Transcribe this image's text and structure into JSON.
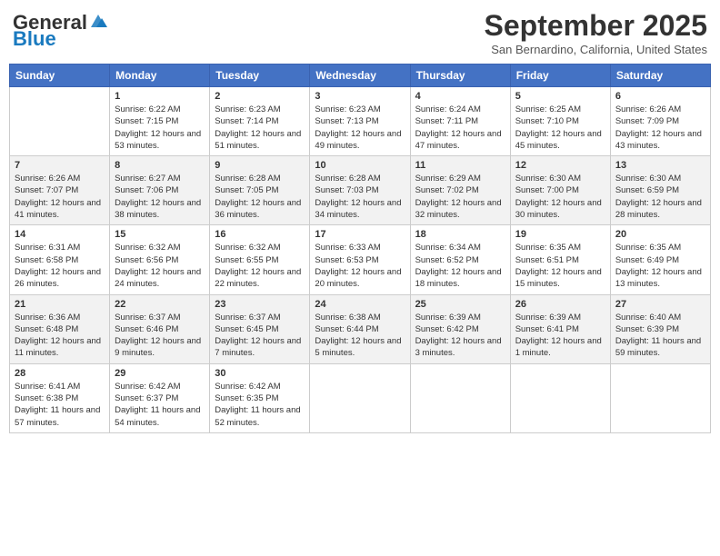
{
  "header": {
    "logo_general": "General",
    "logo_blue": "Blue",
    "month": "September 2025",
    "location": "San Bernardino, California, United States"
  },
  "days_of_week": [
    "Sunday",
    "Monday",
    "Tuesday",
    "Wednesday",
    "Thursday",
    "Friday",
    "Saturday"
  ],
  "weeks": [
    [
      {
        "day": "",
        "sunrise": "",
        "sunset": "",
        "daylight": ""
      },
      {
        "day": "1",
        "sunrise": "Sunrise: 6:22 AM",
        "sunset": "Sunset: 7:15 PM",
        "daylight": "Daylight: 12 hours and 53 minutes."
      },
      {
        "day": "2",
        "sunrise": "Sunrise: 6:23 AM",
        "sunset": "Sunset: 7:14 PM",
        "daylight": "Daylight: 12 hours and 51 minutes."
      },
      {
        "day": "3",
        "sunrise": "Sunrise: 6:23 AM",
        "sunset": "Sunset: 7:13 PM",
        "daylight": "Daylight: 12 hours and 49 minutes."
      },
      {
        "day": "4",
        "sunrise": "Sunrise: 6:24 AM",
        "sunset": "Sunset: 7:11 PM",
        "daylight": "Daylight: 12 hours and 47 minutes."
      },
      {
        "day": "5",
        "sunrise": "Sunrise: 6:25 AM",
        "sunset": "Sunset: 7:10 PM",
        "daylight": "Daylight: 12 hours and 45 minutes."
      },
      {
        "day": "6",
        "sunrise": "Sunrise: 6:26 AM",
        "sunset": "Sunset: 7:09 PM",
        "daylight": "Daylight: 12 hours and 43 minutes."
      }
    ],
    [
      {
        "day": "7",
        "sunrise": "Sunrise: 6:26 AM",
        "sunset": "Sunset: 7:07 PM",
        "daylight": "Daylight: 12 hours and 41 minutes."
      },
      {
        "day": "8",
        "sunrise": "Sunrise: 6:27 AM",
        "sunset": "Sunset: 7:06 PM",
        "daylight": "Daylight: 12 hours and 38 minutes."
      },
      {
        "day": "9",
        "sunrise": "Sunrise: 6:28 AM",
        "sunset": "Sunset: 7:05 PM",
        "daylight": "Daylight: 12 hours and 36 minutes."
      },
      {
        "day": "10",
        "sunrise": "Sunrise: 6:28 AM",
        "sunset": "Sunset: 7:03 PM",
        "daylight": "Daylight: 12 hours and 34 minutes."
      },
      {
        "day": "11",
        "sunrise": "Sunrise: 6:29 AM",
        "sunset": "Sunset: 7:02 PM",
        "daylight": "Daylight: 12 hours and 32 minutes."
      },
      {
        "day": "12",
        "sunrise": "Sunrise: 6:30 AM",
        "sunset": "Sunset: 7:00 PM",
        "daylight": "Daylight: 12 hours and 30 minutes."
      },
      {
        "day": "13",
        "sunrise": "Sunrise: 6:30 AM",
        "sunset": "Sunset: 6:59 PM",
        "daylight": "Daylight: 12 hours and 28 minutes."
      }
    ],
    [
      {
        "day": "14",
        "sunrise": "Sunrise: 6:31 AM",
        "sunset": "Sunset: 6:58 PM",
        "daylight": "Daylight: 12 hours and 26 minutes."
      },
      {
        "day": "15",
        "sunrise": "Sunrise: 6:32 AM",
        "sunset": "Sunset: 6:56 PM",
        "daylight": "Daylight: 12 hours and 24 minutes."
      },
      {
        "day": "16",
        "sunrise": "Sunrise: 6:32 AM",
        "sunset": "Sunset: 6:55 PM",
        "daylight": "Daylight: 12 hours and 22 minutes."
      },
      {
        "day": "17",
        "sunrise": "Sunrise: 6:33 AM",
        "sunset": "Sunset: 6:53 PM",
        "daylight": "Daylight: 12 hours and 20 minutes."
      },
      {
        "day": "18",
        "sunrise": "Sunrise: 6:34 AM",
        "sunset": "Sunset: 6:52 PM",
        "daylight": "Daylight: 12 hours and 18 minutes."
      },
      {
        "day": "19",
        "sunrise": "Sunrise: 6:35 AM",
        "sunset": "Sunset: 6:51 PM",
        "daylight": "Daylight: 12 hours and 15 minutes."
      },
      {
        "day": "20",
        "sunrise": "Sunrise: 6:35 AM",
        "sunset": "Sunset: 6:49 PM",
        "daylight": "Daylight: 12 hours and 13 minutes."
      }
    ],
    [
      {
        "day": "21",
        "sunrise": "Sunrise: 6:36 AM",
        "sunset": "Sunset: 6:48 PM",
        "daylight": "Daylight: 12 hours and 11 minutes."
      },
      {
        "day": "22",
        "sunrise": "Sunrise: 6:37 AM",
        "sunset": "Sunset: 6:46 PM",
        "daylight": "Daylight: 12 hours and 9 minutes."
      },
      {
        "day": "23",
        "sunrise": "Sunrise: 6:37 AM",
        "sunset": "Sunset: 6:45 PM",
        "daylight": "Daylight: 12 hours and 7 minutes."
      },
      {
        "day": "24",
        "sunrise": "Sunrise: 6:38 AM",
        "sunset": "Sunset: 6:44 PM",
        "daylight": "Daylight: 12 hours and 5 minutes."
      },
      {
        "day": "25",
        "sunrise": "Sunrise: 6:39 AM",
        "sunset": "Sunset: 6:42 PM",
        "daylight": "Daylight: 12 hours and 3 minutes."
      },
      {
        "day": "26",
        "sunrise": "Sunrise: 6:39 AM",
        "sunset": "Sunset: 6:41 PM",
        "daylight": "Daylight: 12 hours and 1 minute."
      },
      {
        "day": "27",
        "sunrise": "Sunrise: 6:40 AM",
        "sunset": "Sunset: 6:39 PM",
        "daylight": "Daylight: 11 hours and 59 minutes."
      }
    ],
    [
      {
        "day": "28",
        "sunrise": "Sunrise: 6:41 AM",
        "sunset": "Sunset: 6:38 PM",
        "daylight": "Daylight: 11 hours and 57 minutes."
      },
      {
        "day": "29",
        "sunrise": "Sunrise: 6:42 AM",
        "sunset": "Sunset: 6:37 PM",
        "daylight": "Daylight: 11 hours and 54 minutes."
      },
      {
        "day": "30",
        "sunrise": "Sunrise: 6:42 AM",
        "sunset": "Sunset: 6:35 PM",
        "daylight": "Daylight: 11 hours and 52 minutes."
      },
      {
        "day": "",
        "sunrise": "",
        "sunset": "",
        "daylight": ""
      },
      {
        "day": "",
        "sunrise": "",
        "sunset": "",
        "daylight": ""
      },
      {
        "day": "",
        "sunrise": "",
        "sunset": "",
        "daylight": ""
      },
      {
        "day": "",
        "sunrise": "",
        "sunset": "",
        "daylight": ""
      }
    ]
  ]
}
